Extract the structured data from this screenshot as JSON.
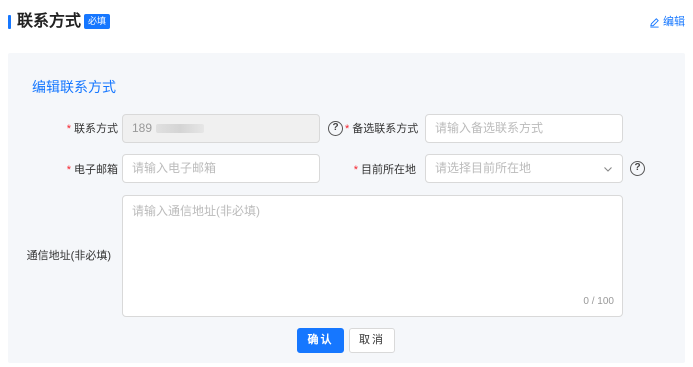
{
  "header": {
    "title": "联系方式",
    "required_badge": "必填",
    "edit_label": "编辑"
  },
  "panel": {
    "title": "编辑联系方式"
  },
  "form": {
    "contact": {
      "label": "联系方式",
      "value": "189"
    },
    "alt_contact": {
      "label": "备选联系方式",
      "placeholder": "请输入备选联系方式"
    },
    "email": {
      "label": "电子邮箱",
      "placeholder": "请输入电子邮箱"
    },
    "location": {
      "label": "目前所在地",
      "placeholder": "请选择目前所在地"
    },
    "address": {
      "label": "通信地址(非必填)",
      "placeholder": "请输入通信地址(非必填)",
      "counter": "0 / 100"
    },
    "required_mark": "*"
  },
  "actions": {
    "confirm_label": "确认",
    "cancel_label": "取消"
  },
  "icons": {
    "edit": "pencil-icon",
    "help": "question-circle-icon",
    "select": "chevron-down-icon"
  },
  "colors": {
    "accent": "#1677ff",
    "required": "#f5222d",
    "panel_bg": "#f5f7fa"
  }
}
